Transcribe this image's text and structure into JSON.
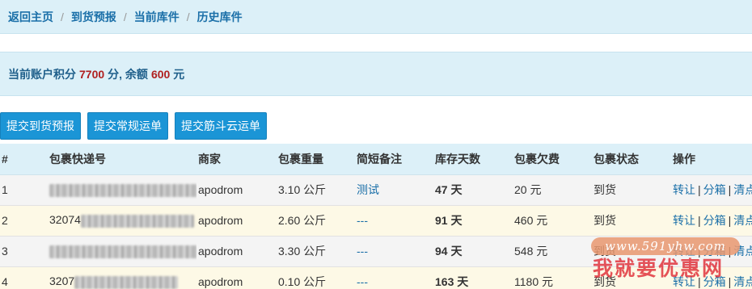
{
  "breadcrumb": [
    "返回主页",
    "到货预报",
    "当前库件",
    "历史库件"
  ],
  "account": {
    "prefix": "当前账户积分",
    "points": "7700",
    "middle": "分, 余额",
    "balance": "600",
    "suffix": "元"
  },
  "buttons": [
    "提交到货预报",
    "提交常规运单",
    "提交筋斗云运单"
  ],
  "table": {
    "columns": [
      "#",
      "包裹快递号",
      "商家",
      "包裹重量",
      "简短备注",
      "库存天数",
      "包裹欠费",
      "包裹状态",
      "操作"
    ],
    "rows": [
      {
        "no": "1",
        "tracking_visible": "",
        "merchant": "apodrom",
        "weight": "3.10 公斤",
        "note": "测试",
        "days": "47 天",
        "fee": "20 元",
        "status": "到货"
      },
      {
        "no": "2",
        "tracking_visible": "32074",
        "merchant": "apodrom",
        "weight": "2.60 公斤",
        "note": "---",
        "days": "91 天",
        "fee": "460 元",
        "status": "到货"
      },
      {
        "no": "3",
        "tracking_visible": "",
        "merchant": "apodrom",
        "weight": "3.30 公斤",
        "note": "---",
        "days": "94 天",
        "fee": "548 元",
        "status": "到货"
      },
      {
        "no": "4",
        "tracking_visible": "3207",
        "merchant": "apodrom",
        "weight": "0.10 公斤",
        "note": "---",
        "days": "163 天",
        "fee": "1180 元",
        "status": "到货"
      }
    ],
    "operations": [
      "转让",
      "分箱",
      "清点"
    ]
  },
  "watermark": {
    "url": "www.591yhw.com",
    "brand": "我就要优惠网"
  },
  "colors": {
    "header_bg": "#dcf0f8",
    "button": "#1b95d6",
    "link": "#1a6fa8",
    "days_red": "#d11b1b",
    "odd_row": "#f4f4f4",
    "even_row": "#fdf9e6"
  }
}
